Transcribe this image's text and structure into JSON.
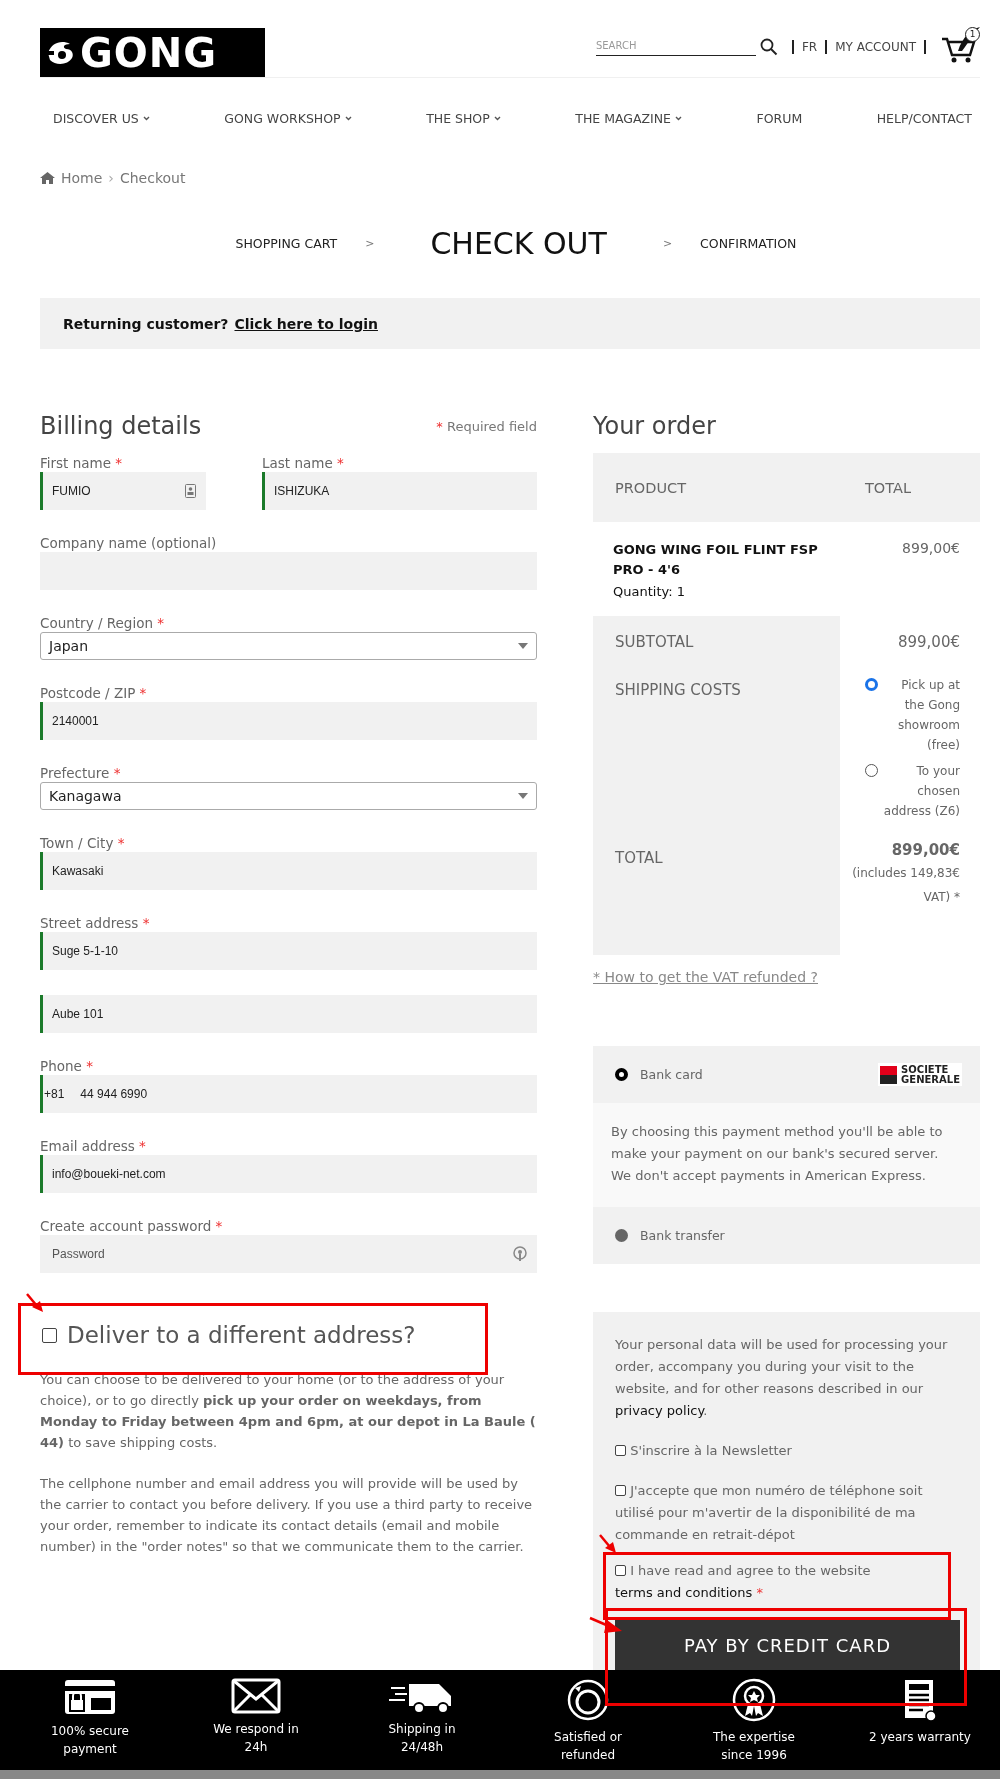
{
  "header": {
    "logo": "GONG",
    "search": {
      "placeholder": "SEARCH"
    },
    "language": "FR",
    "account": "MY ACCOUNT",
    "cart_count": "1"
  },
  "nav": [
    {
      "label": "DISCOVER US",
      "has_dropdown": true
    },
    {
      "label": "GONG WORKSHOP",
      "has_dropdown": true
    },
    {
      "label": "THE SHOP",
      "has_dropdown": true
    },
    {
      "label": "THE MAGAZINE",
      "has_dropdown": true
    },
    {
      "label": "FORUM",
      "has_dropdown": false
    },
    {
      "label": "HELP/CONTACT",
      "has_dropdown": false
    }
  ],
  "breadcrumb": [
    {
      "label": "Home",
      "separator": "›"
    },
    {
      "label": "Checkout"
    }
  ],
  "steps": [
    {
      "kind": "step",
      "label": "SHOPPING CART",
      "current": false
    },
    {
      "kind": "separator",
      "label": ">"
    },
    {
      "kind": "step",
      "label": "CHECK OUT",
      "current": true
    },
    {
      "kind": "separator",
      "label": ">"
    },
    {
      "kind": "step",
      "label": "CONFIRMATION",
      "current": false
    }
  ],
  "login_notice": {
    "text": "Returning customer?",
    "link": "Click here to login"
  },
  "billing": {
    "title": "Billing details",
    "required_note": {
      "mark": "*",
      "text": "Required field"
    },
    "fields": [
      {
        "label": "First name",
        "mark": "*",
        "kind": "text",
        "value": "FUMIO",
        "valid": true,
        "autofill_icon": true
      },
      {
        "label": "Last name",
        "mark": "*",
        "kind": "text",
        "value": "ISHIZUKA",
        "valid": true
      },
      {
        "label": "Company name (optional)",
        "kind": "text",
        "valid": false
      },
      {
        "label": "Country / Region",
        "mark": "*",
        "kind": "select",
        "value": "Japan"
      },
      {
        "label": "Postcode / ZIP",
        "mark": "*",
        "kind": "text",
        "value": "2140001",
        "valid": true
      },
      {
        "label": "Prefecture",
        "mark": "*",
        "kind": "select",
        "value": "Kanagawa"
      },
      {
        "label": "Town / City",
        "mark": "*",
        "kind": "text",
        "value": "Kawasaki",
        "valid": true
      },
      {
        "label": "Street address",
        "mark": "*",
        "kind": "text",
        "value": "Suge 5-1-10",
        "valid": true
      },
      {
        "kind": "text",
        "value": "Aube 101",
        "valid": true
      },
      {
        "label": "Phone",
        "mark": "*",
        "kind": "phone",
        "prefix": "+81",
        "value": "44 944 6990",
        "valid": true
      },
      {
        "label": "Email address",
        "mark": "*",
        "kind": "text",
        "value": "info@boueki-net.com",
        "valid": true
      },
      {
        "label": "Create account password",
        "mark": "*",
        "kind": "password",
        "placeholder": "Password",
        "valid": false
      }
    ],
    "different_address": {
      "label": "Deliver to a different address?",
      "checked": false,
      "highlighted": true
    },
    "notes": [
      "You can choose to be delivered to your home (or to the address of your choice), or to go directly **pick up your order on weekdays, from Monday to Friday between 4pm and 6pm, at our depot in La Baule ( 44)** to save shipping costs.",
      "The cellphone number and email address you will provide will be used by the carrier to contact you before delivery. If you use a third party to receive your order, remember to indicate its contact details (email and mobile number) in the \"order notes\" so that we communicate them to the carrier."
    ]
  },
  "order": {
    "title": "Your order",
    "columns": [
      "PRODUCT",
      "TOTAL"
    ],
    "product": {
      "name": "GONG WING FOIL FLINT FSP PRO - 4'6",
      "quantity": "Quantity: 1",
      "total": "899,00€"
    },
    "subtotal": {
      "label": "SUBTOTAL",
      "value": "899,00€"
    },
    "shipping": {
      "label": "SHIPPING COSTS",
      "options": [
        {
          "label": "Pick up at the Gong showroom (free)",
          "selected": true
        },
        {
          "label": "To your chosen address (Z6)",
          "selected": false
        }
      ]
    },
    "total": {
      "label": "TOTAL",
      "value": "899,00€",
      "note": "(includes 149,83€ VAT) *"
    },
    "vat_link": "* How to get the VAT refunded ?"
  },
  "payment": {
    "methods": [
      {
        "label": "Bank card",
        "selected": true,
        "logo": [
          "SOCIETE",
          "GENERALE"
        ],
        "description": "By choosing this payment method you'll be able to make your payment on our bank's secured server. We don't accept payments in American Express."
      },
      {
        "label": "Bank transfer",
        "selected": false
      }
    ]
  },
  "consent": {
    "text": "Your personal data will be used for processing your order, accompany you during your visit to the website, and for other reasons described in our",
    "link": "privacy policy",
    "after": ".",
    "checkboxes": [
      {
        "label": "S'inscrire à la Newsletter",
        "checked": false,
        "highlighted": false
      },
      {
        "label": "J'accepte que mon numéro de téléphone soit utilisé pour m'avertir de la disponibilité de ma commande en retrait-dépot",
        "checked": false,
        "highlighted": false
      },
      {
        "label": "I have read and agree to the website",
        "link": "terms and conditions",
        "mark": "*",
        "checked": false,
        "highlighted": true
      }
    ],
    "button": {
      "label": "PAY BY CREDIT CARD",
      "highlighted": true
    }
  },
  "footer": [
    {
      "kind": "card",
      "label": "100% secure payment"
    },
    {
      "kind": "mail",
      "label": "We respond in 24h"
    },
    {
      "kind": "van",
      "label": "Shipping in 24/48h"
    },
    {
      "kind": "days",
      "label": "Satisfied or refunded"
    },
    {
      "kind": "medal",
      "label": "The expertise since 1996"
    },
    {
      "kind": "calc",
      "label": "2 years warranty"
    }
  ]
}
